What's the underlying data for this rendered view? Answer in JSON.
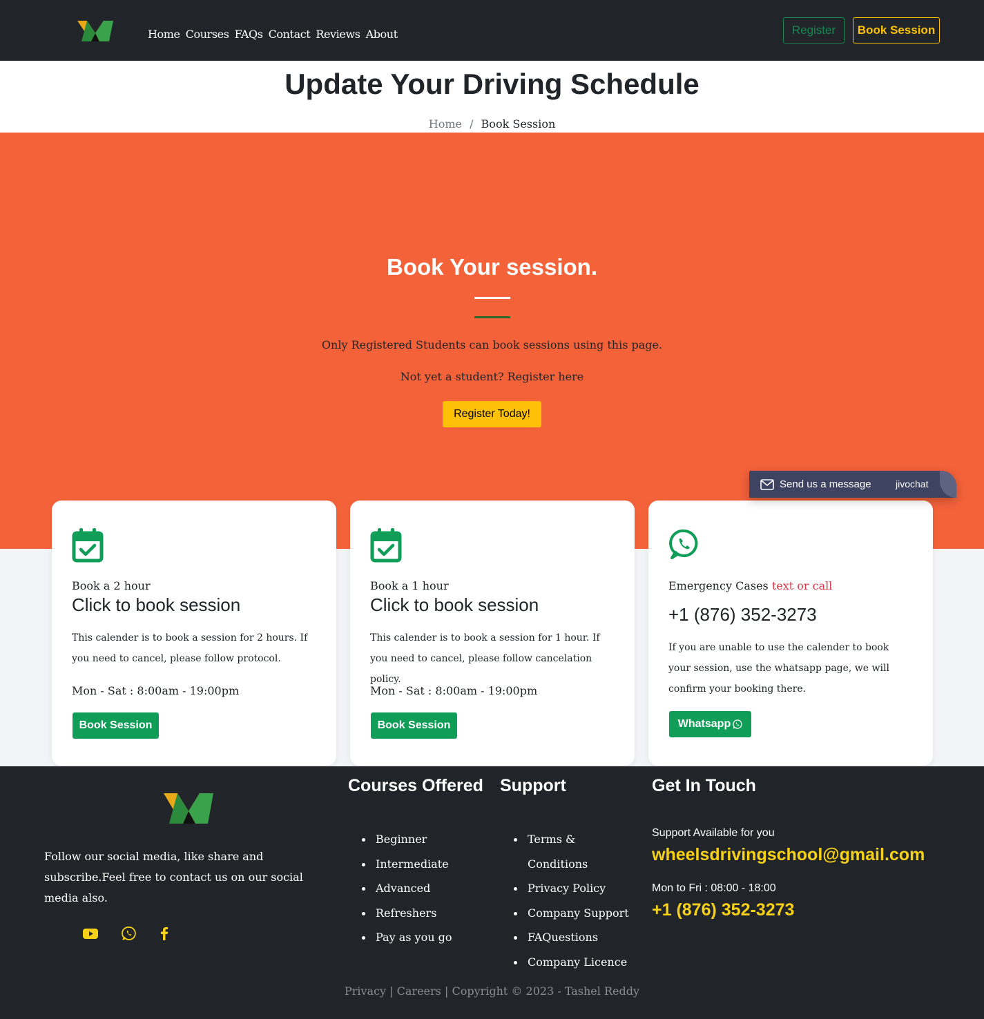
{
  "nav": {
    "links": [
      "Home",
      "Courses",
      "FAQs",
      "Contact",
      "Reviews",
      "About"
    ],
    "register_label": "Register",
    "book_label": "Book Session"
  },
  "header": {
    "title": "Update Your Driving Schedule",
    "breadcrumb": {
      "home": "Home",
      "separator": "/",
      "current": "Book Session"
    }
  },
  "hero": {
    "title": "Book Your session.",
    "line1": "Only Registered Students can book sessions using this page.",
    "line2": "Not yet a student? Register here",
    "button_label": "Register Today!"
  },
  "cards": [
    {
      "icon": "calendar-check-icon",
      "kicker": "Book a 2 hour",
      "heading": "Click to book session",
      "description": "This calender is to book a session for 2 hours. If you need to cancel, please follow protocol.",
      "hours": "Mon - Sat : 8:00am - 19:00pm",
      "button_label": "Book Session"
    },
    {
      "icon": "calendar-check-icon",
      "kicker": "Book a 1 hour",
      "heading": "Click to book session",
      "description": "This calender is to book a session for 1 hour. If you need to cancel, please follow cancelation policy.",
      "hours": "Mon - Sat : 8:00am - 19:00pm",
      "button_label": "Book Session"
    },
    {
      "icon": "whatsapp-icon",
      "kicker": "Emergency Cases",
      "kicker_accent": "text or call",
      "heading": "+1 (876) 352-3273",
      "description": "If you are unable to use the calender to book your session, use the whatsapp page, we will confirm your booking there.",
      "button_label": "Whatsapp"
    }
  ],
  "chat": {
    "label": "Send us a message",
    "brand": "jivochat"
  },
  "footer": {
    "about": "Follow our social media, like share and subscribe.Feel free to contact us on our social media also.",
    "social_icons": [
      "youtube-icon",
      "whatsapp-icon",
      "facebook-icon"
    ],
    "courses_title": "Courses Offered",
    "courses": [
      "Beginner",
      "Intermediate",
      "Advanced",
      "Refreshers",
      "Pay as you go"
    ],
    "support_title": "Support",
    "support": [
      "Terms & Conditions",
      "Privacy Policy",
      "Company Support",
      "FAQuestions",
      "Company Licence"
    ],
    "contact_title": "Get In Touch",
    "support_available": "Support Available for you",
    "email": "wheelsdrivingschool@gmail.com",
    "hours": "Mon to Fri : 08:00 - 18:00",
    "phone": "+1 (876) 352-3273",
    "copyright": "Privacy | Careers  | Copyright © 2023 - Tashel Reddy"
  },
  "colors": {
    "nav_bg": "#212529",
    "hero_bg": "#f4623a",
    "brand_green": "#0f9d58",
    "accent_yellow": "#ffc107",
    "footer_highlight": "#f7d117",
    "danger": "#dc3545"
  }
}
